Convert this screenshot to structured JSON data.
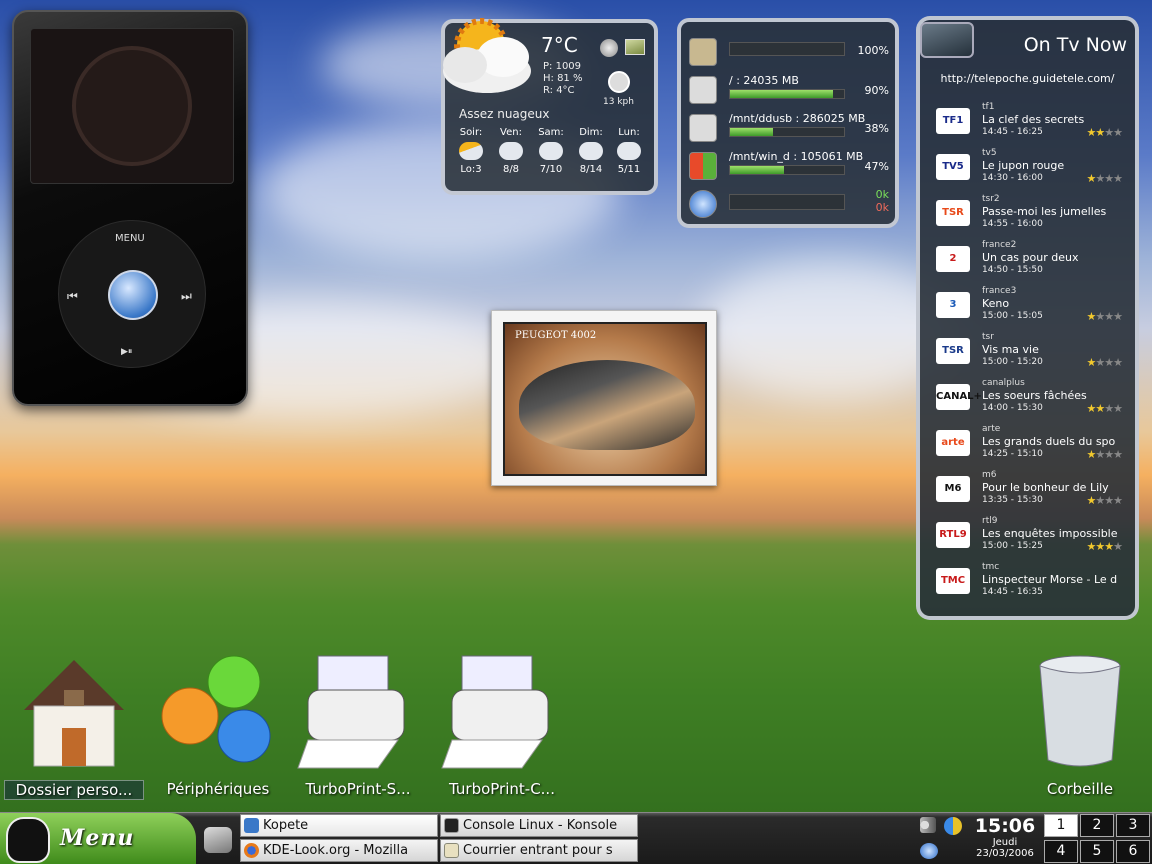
{
  "ipod": {
    "menu": "MENU",
    "prev": "⏮",
    "next": "⏭",
    "playpause": "▶⏸"
  },
  "weather": {
    "temp": "7°C",
    "pressure": "P: 1009",
    "humidity": "H: 81 %",
    "realfeel": "R: 4°C",
    "wind": "13 kph",
    "condition": "Assez nuageux",
    "days": [
      {
        "name": "Soir:",
        "temp": "Lo:3"
      },
      {
        "name": "Ven:",
        "temp": "8/8"
      },
      {
        "name": "Sam:",
        "temp": "7/10"
      },
      {
        "name": "Dim:",
        "temp": "8/14"
      },
      {
        "name": "Lun:",
        "temp": "5/11"
      }
    ]
  },
  "sysmon": {
    "rows": [
      {
        "label": "",
        "pct": "100%",
        "fill": 1.0
      },
      {
        "label": "/ : 24035 MB",
        "pct": "90%",
        "fill": 0.9
      },
      {
        "label": "/mnt/ddusb : 286025 MB",
        "pct": "38%",
        "fill": 0.38
      },
      {
        "label": "/mnt/win_d : 105061 MB",
        "pct": "47%",
        "fill": 0.47
      }
    ],
    "net_in": "0k",
    "net_out": "0k"
  },
  "tv": {
    "title": "On Tv Now",
    "url": "http://telepoche.guidetele.com/",
    "programs": [
      {
        "channel": "tf1",
        "logo": "TF1",
        "title": "La clef des secrets",
        "time": "14:45 - 16:25",
        "stars": 2
      },
      {
        "channel": "tv5",
        "logo": "TV5",
        "title": "Le jupon rouge",
        "time": "14:30 - 16:00",
        "stars": 1
      },
      {
        "channel": "tsr2",
        "logo": "TSR",
        "title": "Passe-moi les jumelles",
        "time": "14:55 - 16:00",
        "stars": 0
      },
      {
        "channel": "france2",
        "logo": "2",
        "title": "Un cas pour deux",
        "time": "14:50 - 15:50",
        "stars": 0
      },
      {
        "channel": "france3",
        "logo": "3",
        "title": "Keno",
        "time": "15:00 - 15:05",
        "stars": 1
      },
      {
        "channel": "tsr",
        "logo": "TSR",
        "title": "Vis ma vie",
        "time": "15:00 - 15:20",
        "stars": 1
      },
      {
        "channel": "canalplus",
        "logo": "CANAL+",
        "title": "Les soeurs fâchées",
        "time": "14:00 - 15:30",
        "stars": 2
      },
      {
        "channel": "arte",
        "logo": "arte",
        "title": "Les grands duels du spo",
        "time": "14:25 - 15:10",
        "stars": 1
      },
      {
        "channel": "m6",
        "logo": "M6",
        "title": "Pour le bonheur de Lily",
        "time": "13:35 - 15:30",
        "stars": 1
      },
      {
        "channel": "rtl9",
        "logo": "RTL9",
        "title": "Les enquêtes impossible",
        "time": "15:00 - 15:25",
        "stars": 3
      },
      {
        "channel": "tmc",
        "logo": "TMC",
        "title": "Linspecteur Morse - Le d",
        "time": "14:45 - 16:35",
        "stars": 0
      }
    ]
  },
  "photo": {
    "caption": "PEUGEOT 4002"
  },
  "desktop": {
    "home": "Dossier perso...",
    "devices": "Périphériques",
    "printer1": "TurboPrint-S...",
    "printer2": "TurboPrint-C...",
    "trash": "Corbeille"
  },
  "taskbar": {
    "menu": "Menu",
    "tasks": [
      "Kopete",
      "Console Linux - Konsole",
      "KDE-Look.org - Mozilla",
      "Courrier entrant pour s"
    ],
    "time": "15:06",
    "day": "Jeudi",
    "date": "23/03/2006",
    "desktops": [
      "1",
      "2",
      "3",
      "4",
      "5",
      "6"
    ]
  },
  "colors": {
    "accent": "#6fbf3a",
    "stars": "#f2c92e",
    "panel": "#283038"
  }
}
